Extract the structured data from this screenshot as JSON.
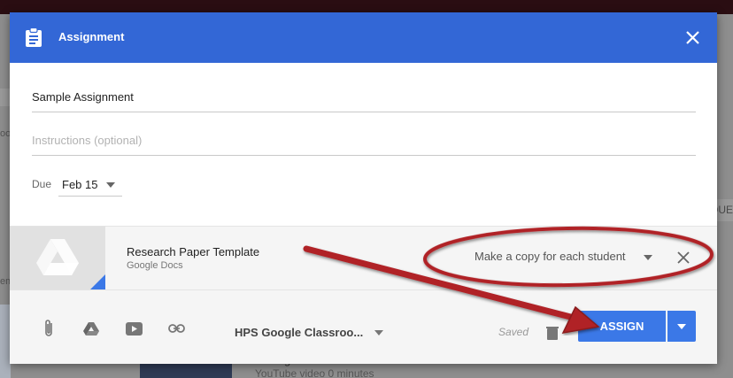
{
  "background": {
    "left_snippets": [
      "oo",
      "em"
    ],
    "right_snippet": "OUE",
    "video": {
      "title": "Writing Ideas: Should Schools Ban Junk Food?",
      "subtitle": "YouTube video   0 minutes"
    }
  },
  "dialog": {
    "title": "Assignment",
    "title_field": {
      "value": "Sample Assignment"
    },
    "instructions_field": {
      "placeholder": "Instructions (optional)"
    },
    "due": {
      "label": "Due",
      "value": "Feb 15"
    },
    "attachment": {
      "name": "Research Paper Template",
      "type": "Google Docs",
      "share_option": "Make a copy for each student"
    },
    "footer": {
      "class_name": "HPS Google Classroo...",
      "status": "Saved",
      "assign_label": "ASSIGN"
    }
  },
  "colors": {
    "header": "#3367d6",
    "assign_button": "#3b78e7",
    "annotation": "#b02228"
  },
  "icons": [
    "assignment-icon",
    "close-icon",
    "attach-file-icon",
    "google-drive-icon",
    "youtube-icon",
    "link-icon",
    "trash-icon",
    "chevron-down-icon"
  ]
}
